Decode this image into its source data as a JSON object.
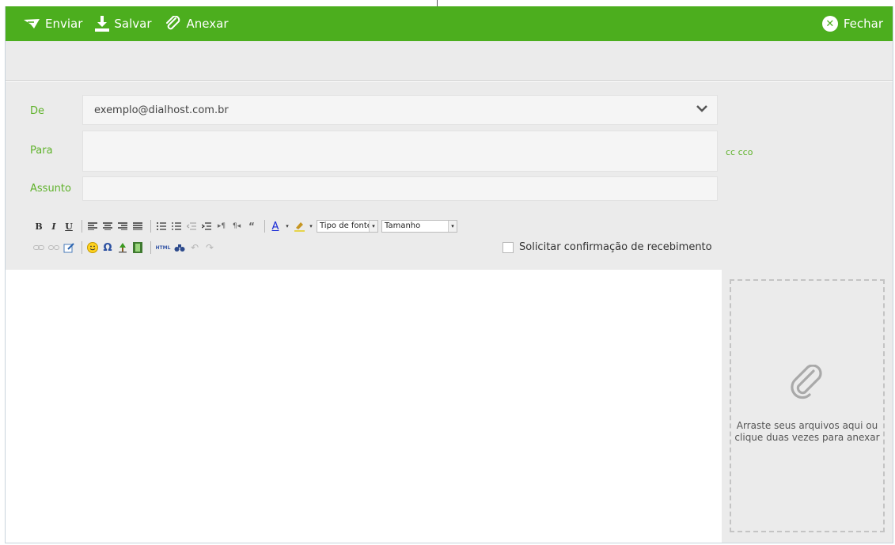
{
  "toolbar": {
    "send_label": "Enviar",
    "save_label": "Salvar",
    "attach_label": "Anexar",
    "close_label": "Fechar"
  },
  "form": {
    "from_label": "De",
    "from_value": "exemplo@dialhost.com.br",
    "to_label": "Para",
    "to_value": "",
    "subject_label": "Assunto",
    "subject_value": "",
    "cc_links": "cc cco"
  },
  "editor_toolbar": {
    "font_select": "Tipo de fonte",
    "size_select": "Tamanho"
  },
  "read_receipt_label": "Solicitar confirmação de recebimento",
  "attach_panel": {
    "hint": "Arraste seus arquivos aqui ou clique duas vezes para anexar"
  },
  "colors": {
    "brand_green": "#4cae1e",
    "label_green": "#5fb22b",
    "panel_gray": "#ebebeb"
  }
}
